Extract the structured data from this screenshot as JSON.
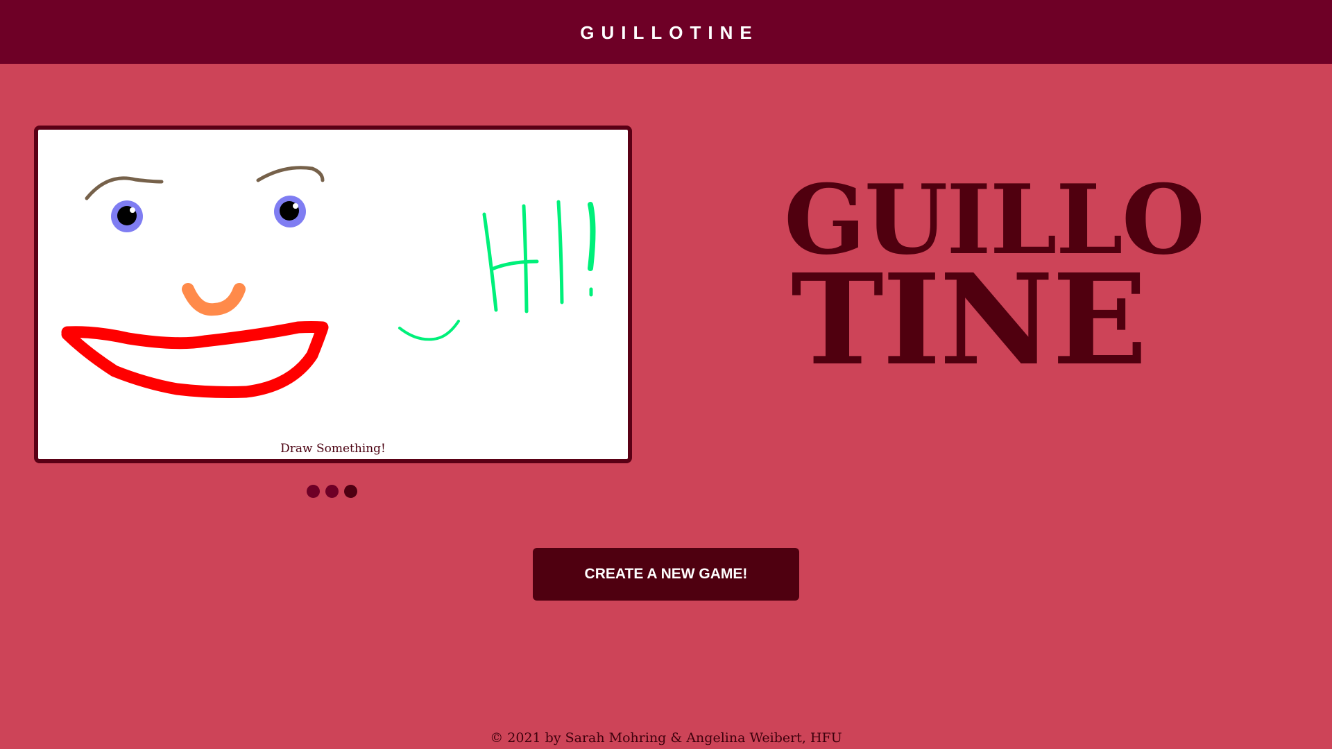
{
  "header": {
    "title": "GUILLOTINE"
  },
  "canvas": {
    "caption": "Draw Something!"
  },
  "carousel": {
    "dot_count": 3,
    "active_index": 2
  },
  "logo": {
    "line1": "GUILLO",
    "line2": "TINE"
  },
  "cta": {
    "label": "CREATE A NEW GAME!"
  },
  "footer": {
    "text": "© 2021 by Sarah Mohring & Angelina Weibert, HFU"
  },
  "colors": {
    "background": "#cd4458",
    "header": "#6e0026",
    "dark_accent": "#4f0012",
    "drawing_brows": "#76614a",
    "drawing_iris": "#7f7df2",
    "drawing_nose": "#ff8a4a",
    "drawing_mouth": "#ff0000",
    "drawing_hi": "#00f07a"
  }
}
